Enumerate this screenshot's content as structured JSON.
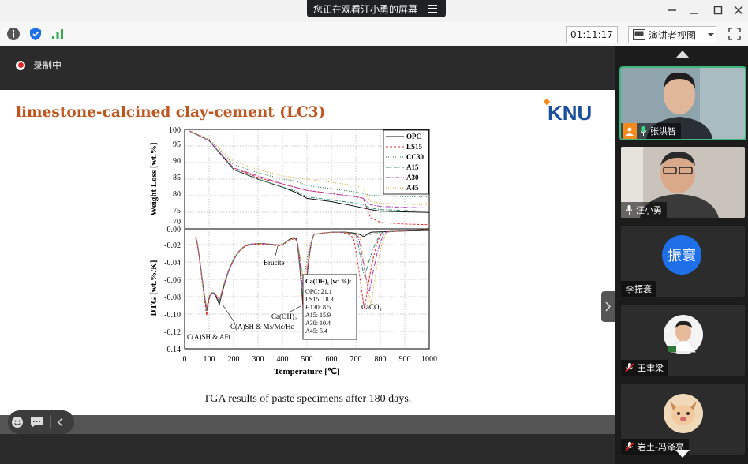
{
  "window": {
    "share_banner": "您正在观看汪小勇的屏幕",
    "timer": "01:11:17",
    "view_mode": "演讲者视图"
  },
  "recording": {
    "label": "录制中"
  },
  "slide": {
    "title": "limestone-calcined clay-cement (LC3)",
    "logo_text": "KNU",
    "caption": "TGA results of paste specimens after 180 days.",
    "figure": {
      "x_label": "Temperature [℃]",
      "x_ticks": [
        "0",
        "100",
        "200",
        "300",
        "400",
        "500",
        "600",
        "700",
        "800",
        "900",
        "1000"
      ],
      "top_y_label": "Weight Loss [wt.%]",
      "top_y_ticks": [
        "100",
        "95",
        "90",
        "85",
        "80",
        "75",
        "70",
        "0.00"
      ],
      "bottom_y_label": "DTG [wt.%/K]",
      "bottom_y_ticks": [
        "-0.02",
        "-0.04",
        "-0.06",
        "-0.08",
        "-0.10",
        "-0.12",
        "-0.14"
      ],
      "legend": [
        "OPC",
        "LS15",
        "CC30",
        "A15",
        "A30",
        "A45"
      ],
      "annotations": {
        "brucite": "Brucite",
        "caoh2": "Ca(OH)₂",
        "caco3": "CaCO₃",
        "csh_aft": "C(A)SH & AFt",
        "csh_ms": "C(A)SH & Ms/Mc/Hc"
      },
      "inset": {
        "title": "Ca(OH)₂ (wt %):",
        "rows": [
          "OPC: 21.1",
          "LS15: 18.3",
          "H130: 8.5",
          "A15: 15.9",
          "A30: 10.4",
          "A45: 5.4"
        ]
      }
    }
  },
  "chart_data": {
    "type": "line",
    "x": [
      20,
      100,
      200,
      300,
      400,
      450,
      500,
      600,
      700,
      730,
      760,
      800,
      900,
      1000
    ],
    "xlim": [
      0,
      1000
    ],
    "ylim": [
      70,
      100
    ],
    "series": [
      {
        "name": "OPC",
        "values": [
          100,
          97,
          88,
          85,
          82.5,
          81,
          79,
          78,
          76.5,
          76,
          75.5,
          75,
          74.8,
          74.6
        ]
      },
      {
        "name": "LS15",
        "values": [
          100,
          97,
          88.5,
          85.5,
          83.5,
          82.5,
          81.5,
          80.5,
          79.5,
          79,
          73,
          71.5,
          71,
          70.8
        ]
      },
      {
        "name": "CC30",
        "values": [
          100,
          97.5,
          89.5,
          87,
          85,
          84.5,
          83,
          82,
          81,
          80.5,
          80,
          79.8,
          79.5,
          79.4
        ]
      },
      {
        "name": "A15",
        "values": [
          100,
          97,
          88,
          85,
          82.5,
          81.5,
          79.5,
          78.5,
          77.5,
          77,
          76,
          75.5,
          75.2,
          75
        ]
      },
      {
        "name": "A30",
        "values": [
          100,
          97,
          88.5,
          86,
          83.5,
          82.5,
          81.5,
          80.5,
          79.5,
          79,
          77,
          76.5,
          76.2,
          76
        ]
      },
      {
        "name": "A45",
        "values": [
          100,
          97.5,
          90.5,
          88,
          86,
          85.5,
          85,
          84,
          83,
          82,
          78,
          77.5,
          77.2,
          77
        ]
      }
    ]
  },
  "participants": [
    {
      "name": "张洪智",
      "type": "video"
    },
    {
      "name": "汪小勇",
      "type": "video"
    },
    {
      "name": "李振寰",
      "type": "avatar",
      "avatar_text": "振寰"
    },
    {
      "name": "王聿梁",
      "type": "photo"
    },
    {
      "name": "岩土-冯泽亮",
      "type": "photo"
    }
  ]
}
